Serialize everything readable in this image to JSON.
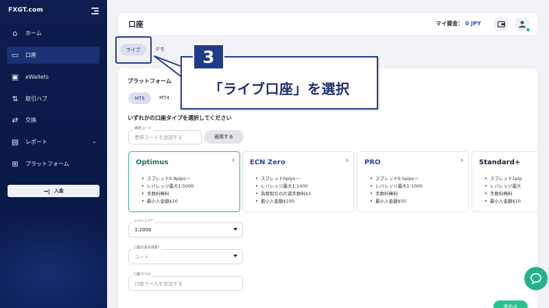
{
  "sidebar": {
    "logo": "FXGT.com",
    "items": [
      {
        "label": "ホーム",
        "icon": "home-icon",
        "glyph": "⌂"
      },
      {
        "label": "口座",
        "icon": "monitor-chart-icon",
        "glyph": "▭"
      },
      {
        "label": "eWallets",
        "icon": "wallet-icon",
        "glyph": "▣"
      },
      {
        "label": "取引ハブ",
        "icon": "transfer-arrows-icon",
        "glyph": "⇅"
      },
      {
        "label": "交換",
        "icon": "exchange-icon",
        "glyph": "⇄"
      },
      {
        "label": "レポート",
        "icon": "report-icon",
        "glyph": "▤"
      },
      {
        "label": "プラットフォーム",
        "icon": "platform-icon",
        "glyph": "⊞"
      }
    ],
    "deposit_label": "入金"
  },
  "header": {
    "title": "口座",
    "funds_label": "マイ資金：",
    "funds_value": "0 JPY"
  },
  "tabs": {
    "live": "ライブ",
    "demo": "デモ"
  },
  "form": {
    "platform_label": "プラットフォーム",
    "platforms": [
      "MT5",
      "MT4"
    ],
    "select_title": "いずれかの口座タイプを選択してください",
    "ref_label": "参照コード",
    "ref_placeholder": "参照コードを追加する",
    "apply_label": "適用する",
    "leverage_label": "レバレッジ*",
    "leverage_value": "1:2000",
    "currency_label": "口座の基本通貨*",
    "currency_placeholder": "コード",
    "account_label_label": "口座ラベル",
    "account_label_placeholder": "口座ラベルを追加する",
    "next_label": "進める"
  },
  "account_types": [
    {
      "name": "Optimus",
      "color": "#1a6b5f",
      "features": [
        "スプレッド0.8pips〜",
        "レバレッジ最大1:5000",
        "手数料無料",
        "最小入金額$10"
      ]
    },
    {
      "name": "ECN Zero",
      "color": "#2a46a6",
      "features": [
        "スプレッド0pips〜",
        "レバレッジ最大1:1000",
        "為替取引の片道手数料$3",
        "最小入金額$100"
      ]
    },
    {
      "name": "PRO",
      "color": "#2a46a6",
      "features": [
        "スプレッド0.5pips〜",
        "レバレッジ最大1:1000",
        "手数料無料",
        "最小入金額$50"
      ]
    },
    {
      "name": "Standard+",
      "color": "#1d2230",
      "features": [
        "スプレッド1pip",
        "レバレッジ最大",
        "手数料無料",
        "最小入金額$10"
      ]
    }
  ],
  "annotation": {
    "step": "3",
    "text": "「ライブ口座」を選択"
  },
  "colors": {
    "accent": "#27c38d",
    "navy": "#1e3a8a",
    "sidebar": "#0c1d4f"
  }
}
